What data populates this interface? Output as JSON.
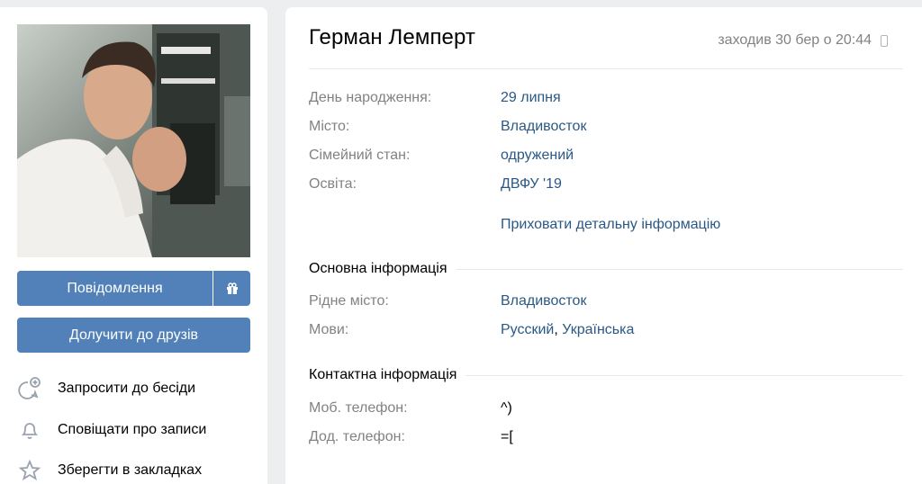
{
  "profile": {
    "name": "Герман Лемперт",
    "last_seen": "заходив 30 бер о 20:44"
  },
  "left": {
    "message_button": "Повідомлення",
    "add_friend_button": "Долучити до друзів",
    "actions": [
      {
        "label": "Запросити до бесіди",
        "icon": "chat-add-icon"
      },
      {
        "label": "Сповіщати про записи",
        "icon": "bell-icon"
      },
      {
        "label": "Зберегти в закладках",
        "icon": "star-icon"
      }
    ]
  },
  "details": [
    {
      "key": "День народження:",
      "value": "29 липня"
    },
    {
      "key": "Місто:",
      "value": "Владивосток"
    },
    {
      "key": "Сімейний стан:",
      "value": "одружений"
    },
    {
      "key": "Освіта:",
      "value": "ДВФУ '19"
    }
  ],
  "hide_details_link": "Приховати детальну інформацію",
  "main_info": {
    "title": "Основна інформація",
    "rows": [
      {
        "key": "Рідне місто:",
        "value": "Владивосток"
      },
      {
        "key": "Мови:",
        "value_1": "Русский",
        "sep": ", ",
        "value_2": "Українська"
      }
    ]
  },
  "contact_info": {
    "title": "Контактна інформація",
    "rows": [
      {
        "key": "Моб. телефон:",
        "value": "^)"
      },
      {
        "key": "Дод. телефон:",
        "value": "=["
      }
    ]
  },
  "colors": {
    "accent": "#5181b8",
    "link": "#2a5885",
    "muted": "#828282",
    "background": "#edeef0"
  }
}
